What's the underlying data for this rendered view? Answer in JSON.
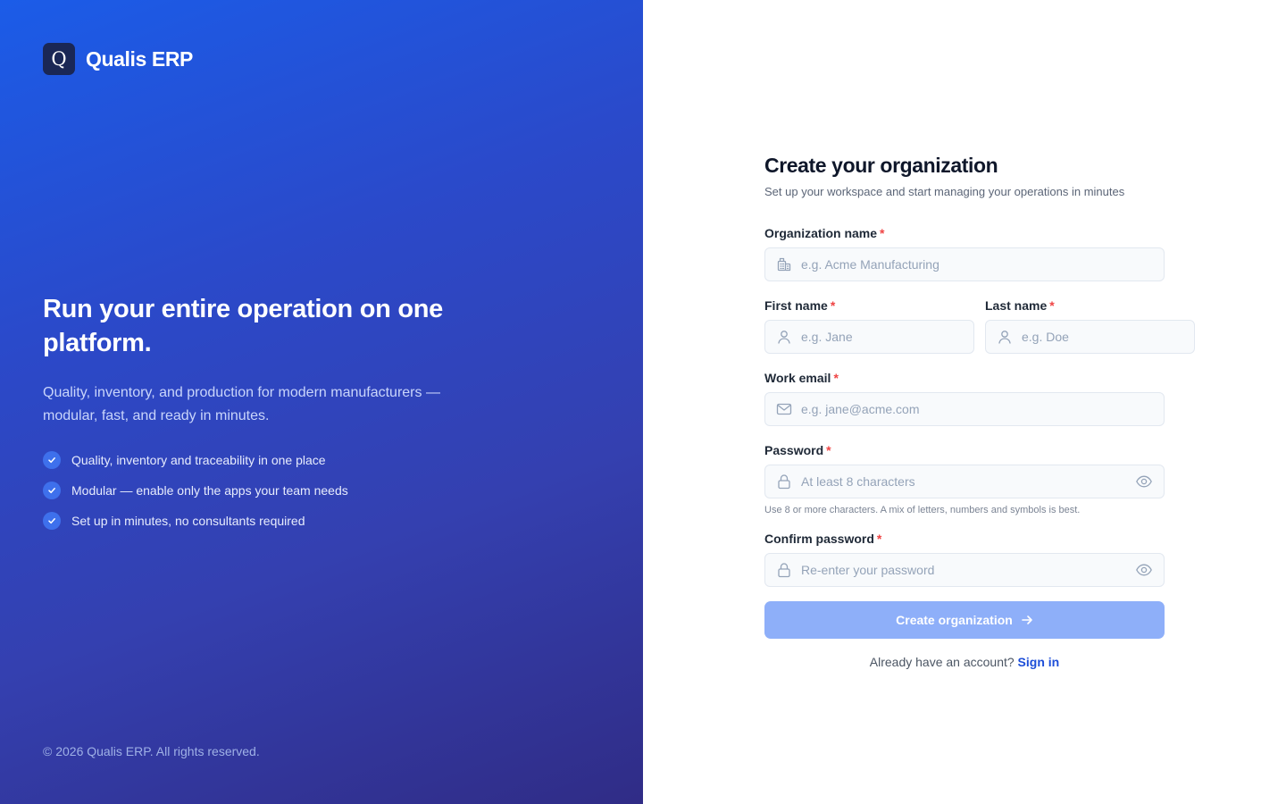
{
  "brand": {
    "mark": "Q",
    "name": "Qualis ERP"
  },
  "hero": {
    "title": "Run your entire operation on one platform.",
    "subtitle": "Quality, inventory, and production for modern manufacturers — modular, fast, and ready in minutes.",
    "features": [
      "Quality, inventory and traceability in one place",
      "Modular — enable only the apps your team needs",
      "Set up in minutes, no consultants required"
    ]
  },
  "footer": {
    "copyright": "© 2026 Qualis ERP. All rights reserved."
  },
  "form": {
    "title": "Create your organization",
    "subtitle": "Set up your workspace and start managing your operations in minutes",
    "required_mark": "*",
    "org_name": {
      "label": "Organization name",
      "placeholder": "e.g. Acme Manufacturing",
      "value": "",
      "icon": "building-icon"
    },
    "first_name": {
      "label": "First name",
      "placeholder": "e.g. Jane",
      "value": "",
      "icon": "user-icon"
    },
    "last_name": {
      "label": "Last name",
      "placeholder": "e.g. Doe",
      "value": "",
      "icon": "user-icon"
    },
    "email": {
      "label": "Work email",
      "placeholder": "e.g. jane@acme.com",
      "value": "",
      "icon": "mail-icon"
    },
    "password": {
      "label": "Password",
      "placeholder": "At least 8 characters",
      "value": "",
      "icon": "lock-icon",
      "hint": "Use 8 or more characters. A mix of letters, numbers and symbols is best."
    },
    "confirm_password": {
      "label": "Confirm password",
      "placeholder": "Re-enter your password",
      "value": "",
      "icon": "lock-icon"
    },
    "submit_label": "Create organization",
    "signin_prompt": "Already have an account?",
    "signin_link": "Sign in"
  },
  "colors": {
    "primary": "#1d4ed8",
    "button_disabled": "#8eaff9",
    "required": "#ef4444",
    "left_gradient_start": "#1b5ce8",
    "left_gradient_end": "#302c86"
  }
}
